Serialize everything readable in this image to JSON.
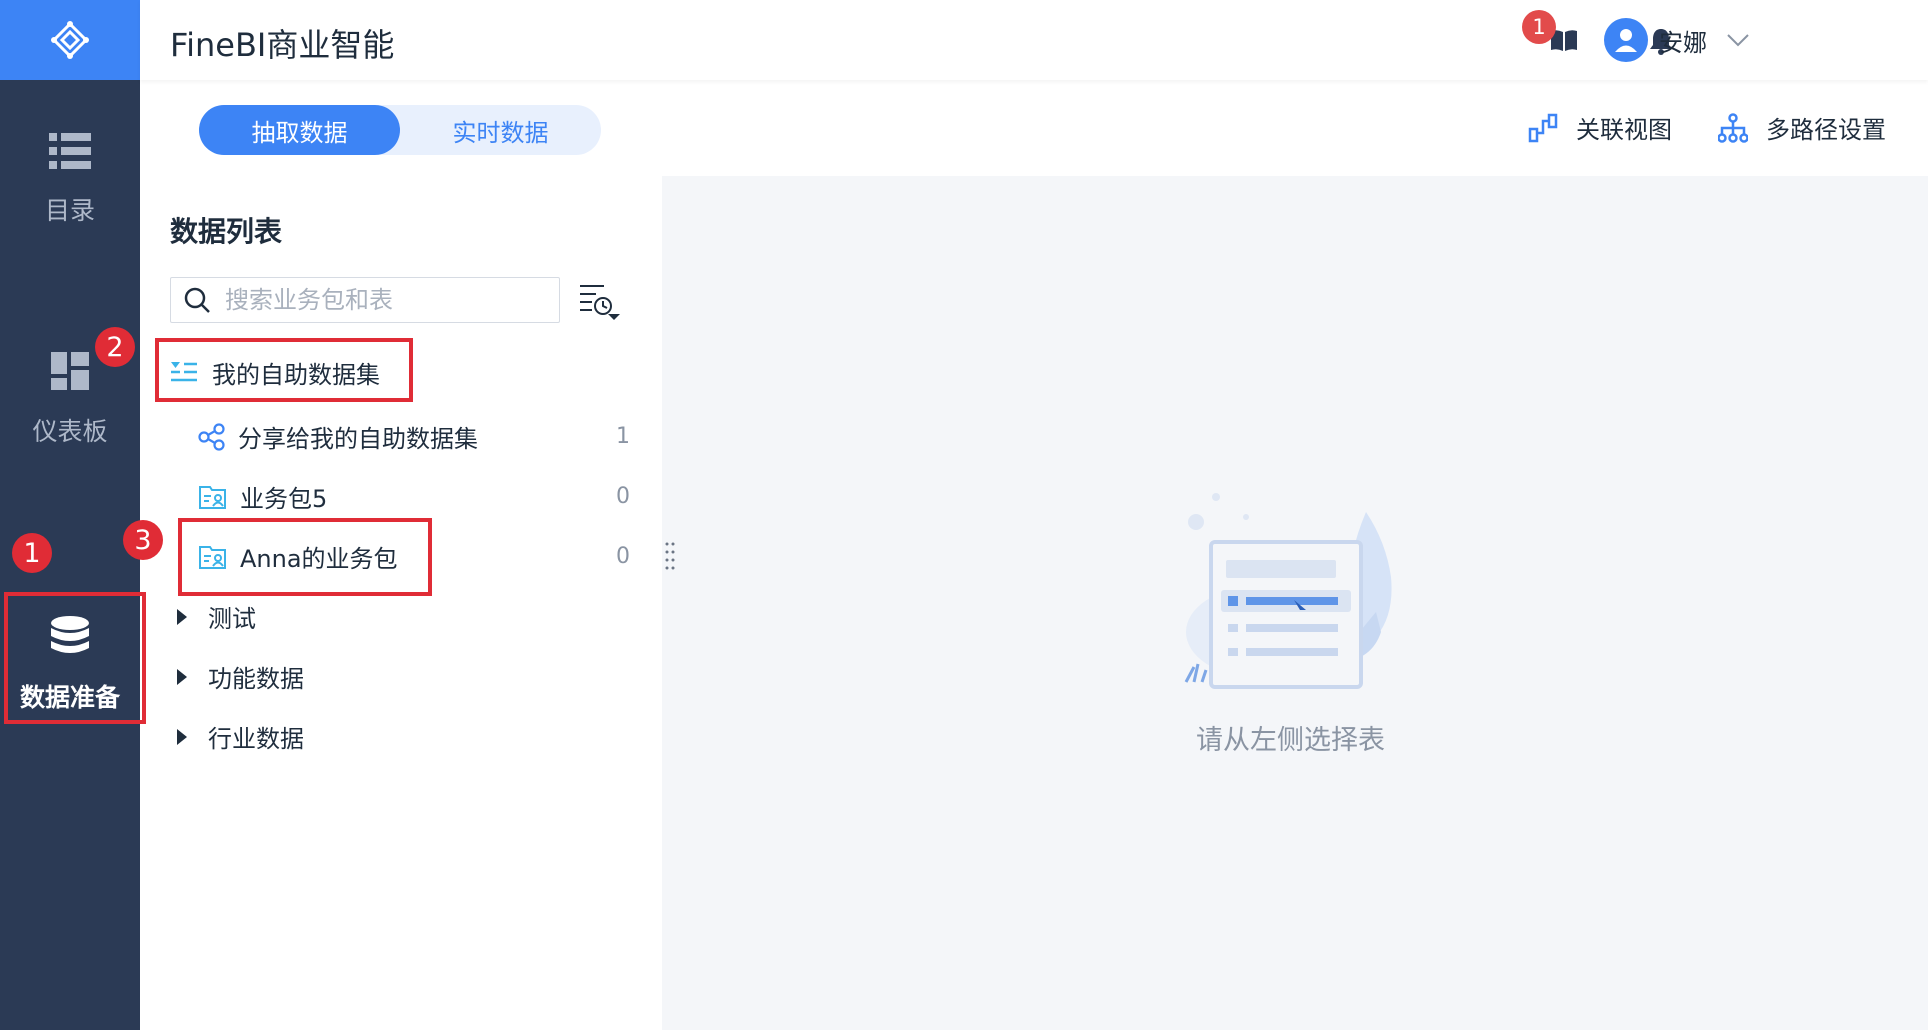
{
  "app": {
    "title": "FineBI商业智能"
  },
  "sidebar": {
    "items": [
      {
        "label": "目录",
        "icon": "list-icon"
      },
      {
        "label": "仪表板",
        "icon": "dashboard-icon"
      },
      {
        "label": "数据准备",
        "icon": "database-icon",
        "active": true
      }
    ]
  },
  "header": {
    "notification_count": "1",
    "user_name": "安娜"
  },
  "tabs": {
    "active": "抽取数据",
    "inactive": "实时数据"
  },
  "actions": {
    "relation_view": "关联视图",
    "multipath": "多路径设置"
  },
  "panel": {
    "title": "数据列表",
    "search_placeholder": "搜索业务包和表",
    "tree": {
      "self_dataset": "我的自助数据集",
      "shared": {
        "label": "分享给我的自助数据集",
        "count": "1"
      },
      "pkg5": {
        "label": "业务包5",
        "count": "0"
      },
      "anna_pkg": {
        "label": "Anna的业务包",
        "count": "0"
      },
      "groups": [
        "测试",
        "功能数据",
        "行业数据"
      ]
    }
  },
  "content": {
    "empty_message": "请从左侧选择表"
  },
  "annotations": [
    "1",
    "2",
    "3"
  ],
  "colors": {
    "primary": "#3d84f5",
    "sidebar": "#2b3a55",
    "highlight": "#e02c36"
  }
}
